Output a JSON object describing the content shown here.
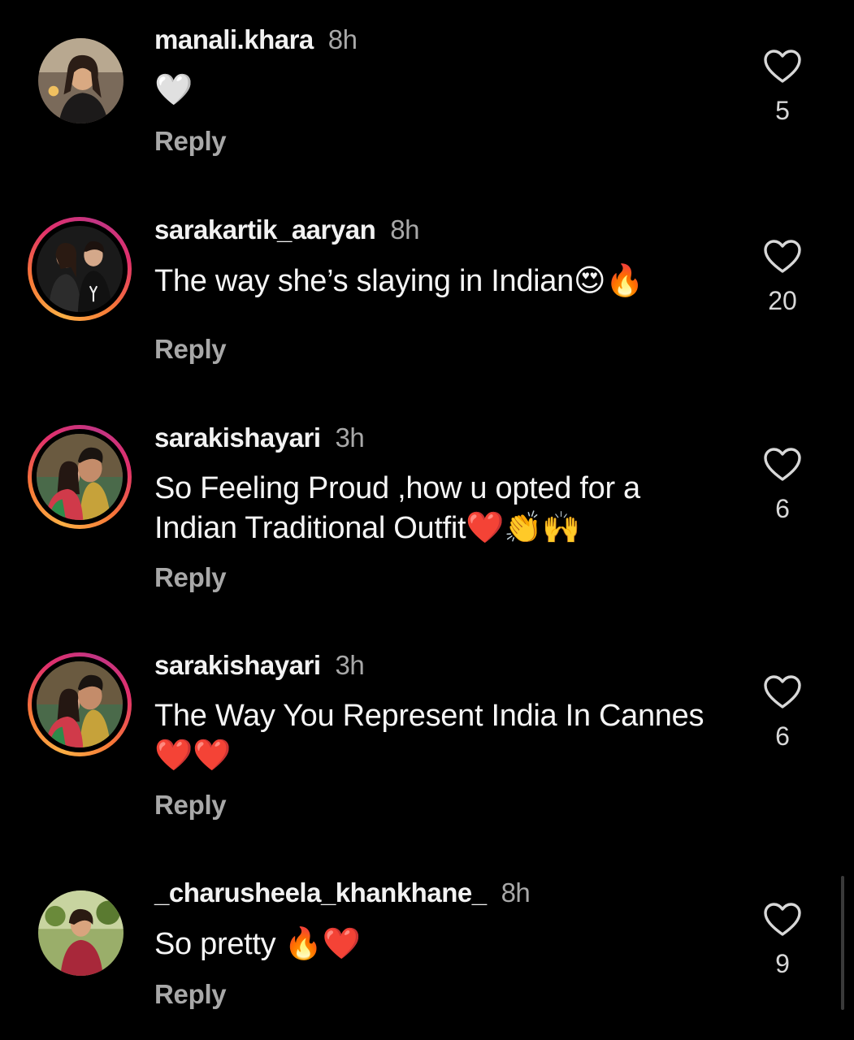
{
  "comments": [
    {
      "username": "manali.khara",
      "time": "8h",
      "text": "",
      "emoji": "🤍",
      "reply_label": "Reply",
      "likes": "5"
    },
    {
      "username": "sarakartik_aaryan",
      "time": "8h",
      "text": "The way she’s slaying in Indian",
      "emoji": "😍🔥",
      "reply_label": "Reply",
      "likes": "20"
    },
    {
      "username": "sarakishayari",
      "time": "3h",
      "text": "So Feeling Proud ,how u opted for a Indian Traditional Outfit",
      "emoji": "❤️👏🙌",
      "reply_label": "Reply",
      "likes": "6"
    },
    {
      "username": "sarakishayari",
      "time": "3h",
      "text": "The Way You Represent  India In Cannes",
      "emoji": "❤️❤️",
      "reply_label": "Reply",
      "likes": "6"
    },
    {
      "username": "_charusheela_khankhane_",
      "time": "8h",
      "text": "So pretty ",
      "emoji": "🔥❤️",
      "reply_label": "Reply",
      "likes": "9"
    }
  ],
  "colors": {
    "background": "#000000",
    "text": "#f5f5f5",
    "muted": "#a8a8a8",
    "story_ring": [
      "#fcaf45",
      "#e1306c",
      "#c13584"
    ]
  },
  "icons": {
    "like": "heart-outline-icon"
  }
}
